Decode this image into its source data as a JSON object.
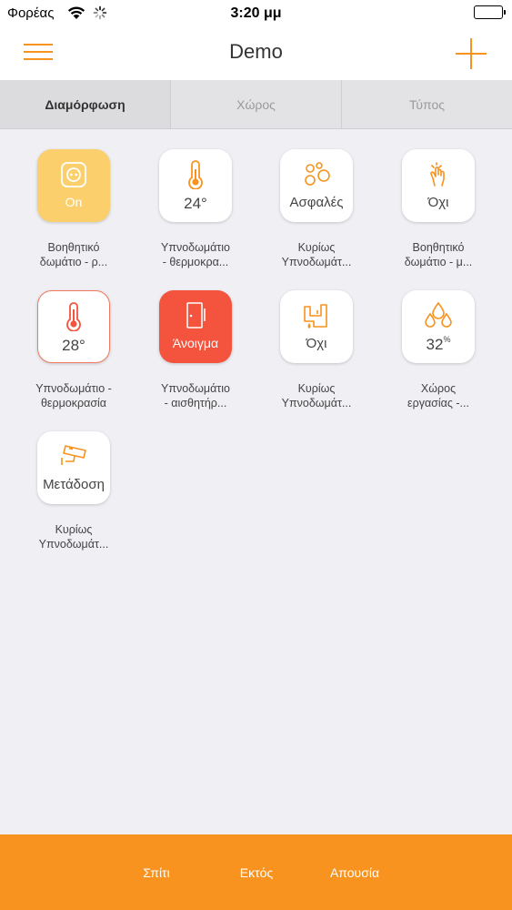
{
  "status_bar": {
    "carrier": "Φορέας",
    "time": "3:20 μμ"
  },
  "nav": {
    "title": "Demo"
  },
  "segments": [
    {
      "label": "Διαμόρφωση",
      "active": true
    },
    {
      "label": "Χώρος",
      "active": false
    },
    {
      "label": "Τύπος",
      "active": false
    }
  ],
  "colors": {
    "accent": "#f7931e",
    "tile_yellow": "#fbcf6c",
    "tile_red": "#f4533d"
  },
  "devices": [
    {
      "icon": "outlet-icon",
      "value": "On",
      "label_line1": "Βοηθητικό",
      "label_line2": "δωμάτιο - ρ..."
    },
    {
      "icon": "thermometer-icon",
      "value": "24°",
      "label_line1": "Υπνοδωμάτιο",
      "label_line2": "- θερμοκρα..."
    },
    {
      "icon": "smoke-icon",
      "value": "Ασφαλές",
      "label_line1": "Κυρίως",
      "label_line2": "Υπνοδωμάτ..."
    },
    {
      "icon": "hand-motion-icon",
      "value": "Όχι",
      "label_line1": "Βοηθητικό",
      "label_line2": "δωμάτιο - μ..."
    },
    {
      "icon": "thermometer-icon",
      "value": "28°",
      "label_line1": "Υπνοδωμάτιο -",
      "label_line2": "θερμοκρασία"
    },
    {
      "icon": "door-icon",
      "value": "Άνοιγμα",
      "label_line1": "Υπνοδωμάτιο",
      "label_line2": "- αισθητήρ..."
    },
    {
      "icon": "water-leak-icon",
      "value": "Όχι",
      "label_line1": "Κυρίως",
      "label_line2": "Υπνοδωμάτ..."
    },
    {
      "icon": "humidity-icon",
      "value": "32",
      "value_unit": "%",
      "label_line1": "Χώρος",
      "label_line2": "εργασίας -..."
    },
    {
      "icon": "camera-icon",
      "value": "Μετάδοση",
      "label_line1": "Κυρίως",
      "label_line2": "Υπνοδωμάτ..."
    }
  ],
  "bottom_bar": {
    "home": "Σπίτι",
    "away": "Εκτός",
    "absence": "Απουσία"
  }
}
